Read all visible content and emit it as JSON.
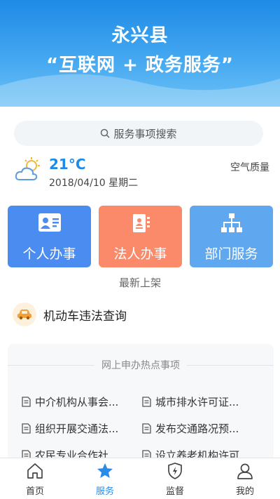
{
  "header": {
    "title_line1": "永兴县",
    "title_line2": "“互联网 + 政务服务”"
  },
  "search": {
    "placeholder": "服务事项搜索",
    "icon": "search-icon"
  },
  "weather": {
    "icon": "partly-cloudy-icon",
    "temperature": "21°C",
    "date": "2018/04/10 星期二",
    "air_quality_label": "空气质量"
  },
  "tiles": [
    {
      "label": "个人办事",
      "icon": "id-card-icon",
      "color": "#4b8cf0"
    },
    {
      "label": "法人办事",
      "icon": "business-book-icon",
      "color": "#fb8a6b"
    },
    {
      "label": "部门服务",
      "icon": "org-chart-icon",
      "color": "#5fa7ef"
    }
  ],
  "newest_label": "最新上架",
  "vehicle": {
    "label": "机动车违法查询",
    "icon": "car-icon"
  },
  "hot": {
    "title": "网上申办热点事项",
    "items": [
      "中介机构从事会...",
      "城市排水许可证...",
      "组织开展交通法...",
      "发布交通路况预...",
      "农民专业合作社...",
      "设立养老机构许可"
    ]
  },
  "tabbar": [
    {
      "label": "首页",
      "icon": "home-icon",
      "active": false
    },
    {
      "label": "服务",
      "icon": "star-icon",
      "active": true
    },
    {
      "label": "监督",
      "icon": "shield-lightning-icon",
      "active": false
    },
    {
      "label": "我的",
      "icon": "user-icon",
      "active": false
    }
  ],
  "colors": {
    "accent": "#2a8ce6",
    "header_top": "#1f8be6",
    "header_bottom": "#6cc1f6"
  }
}
